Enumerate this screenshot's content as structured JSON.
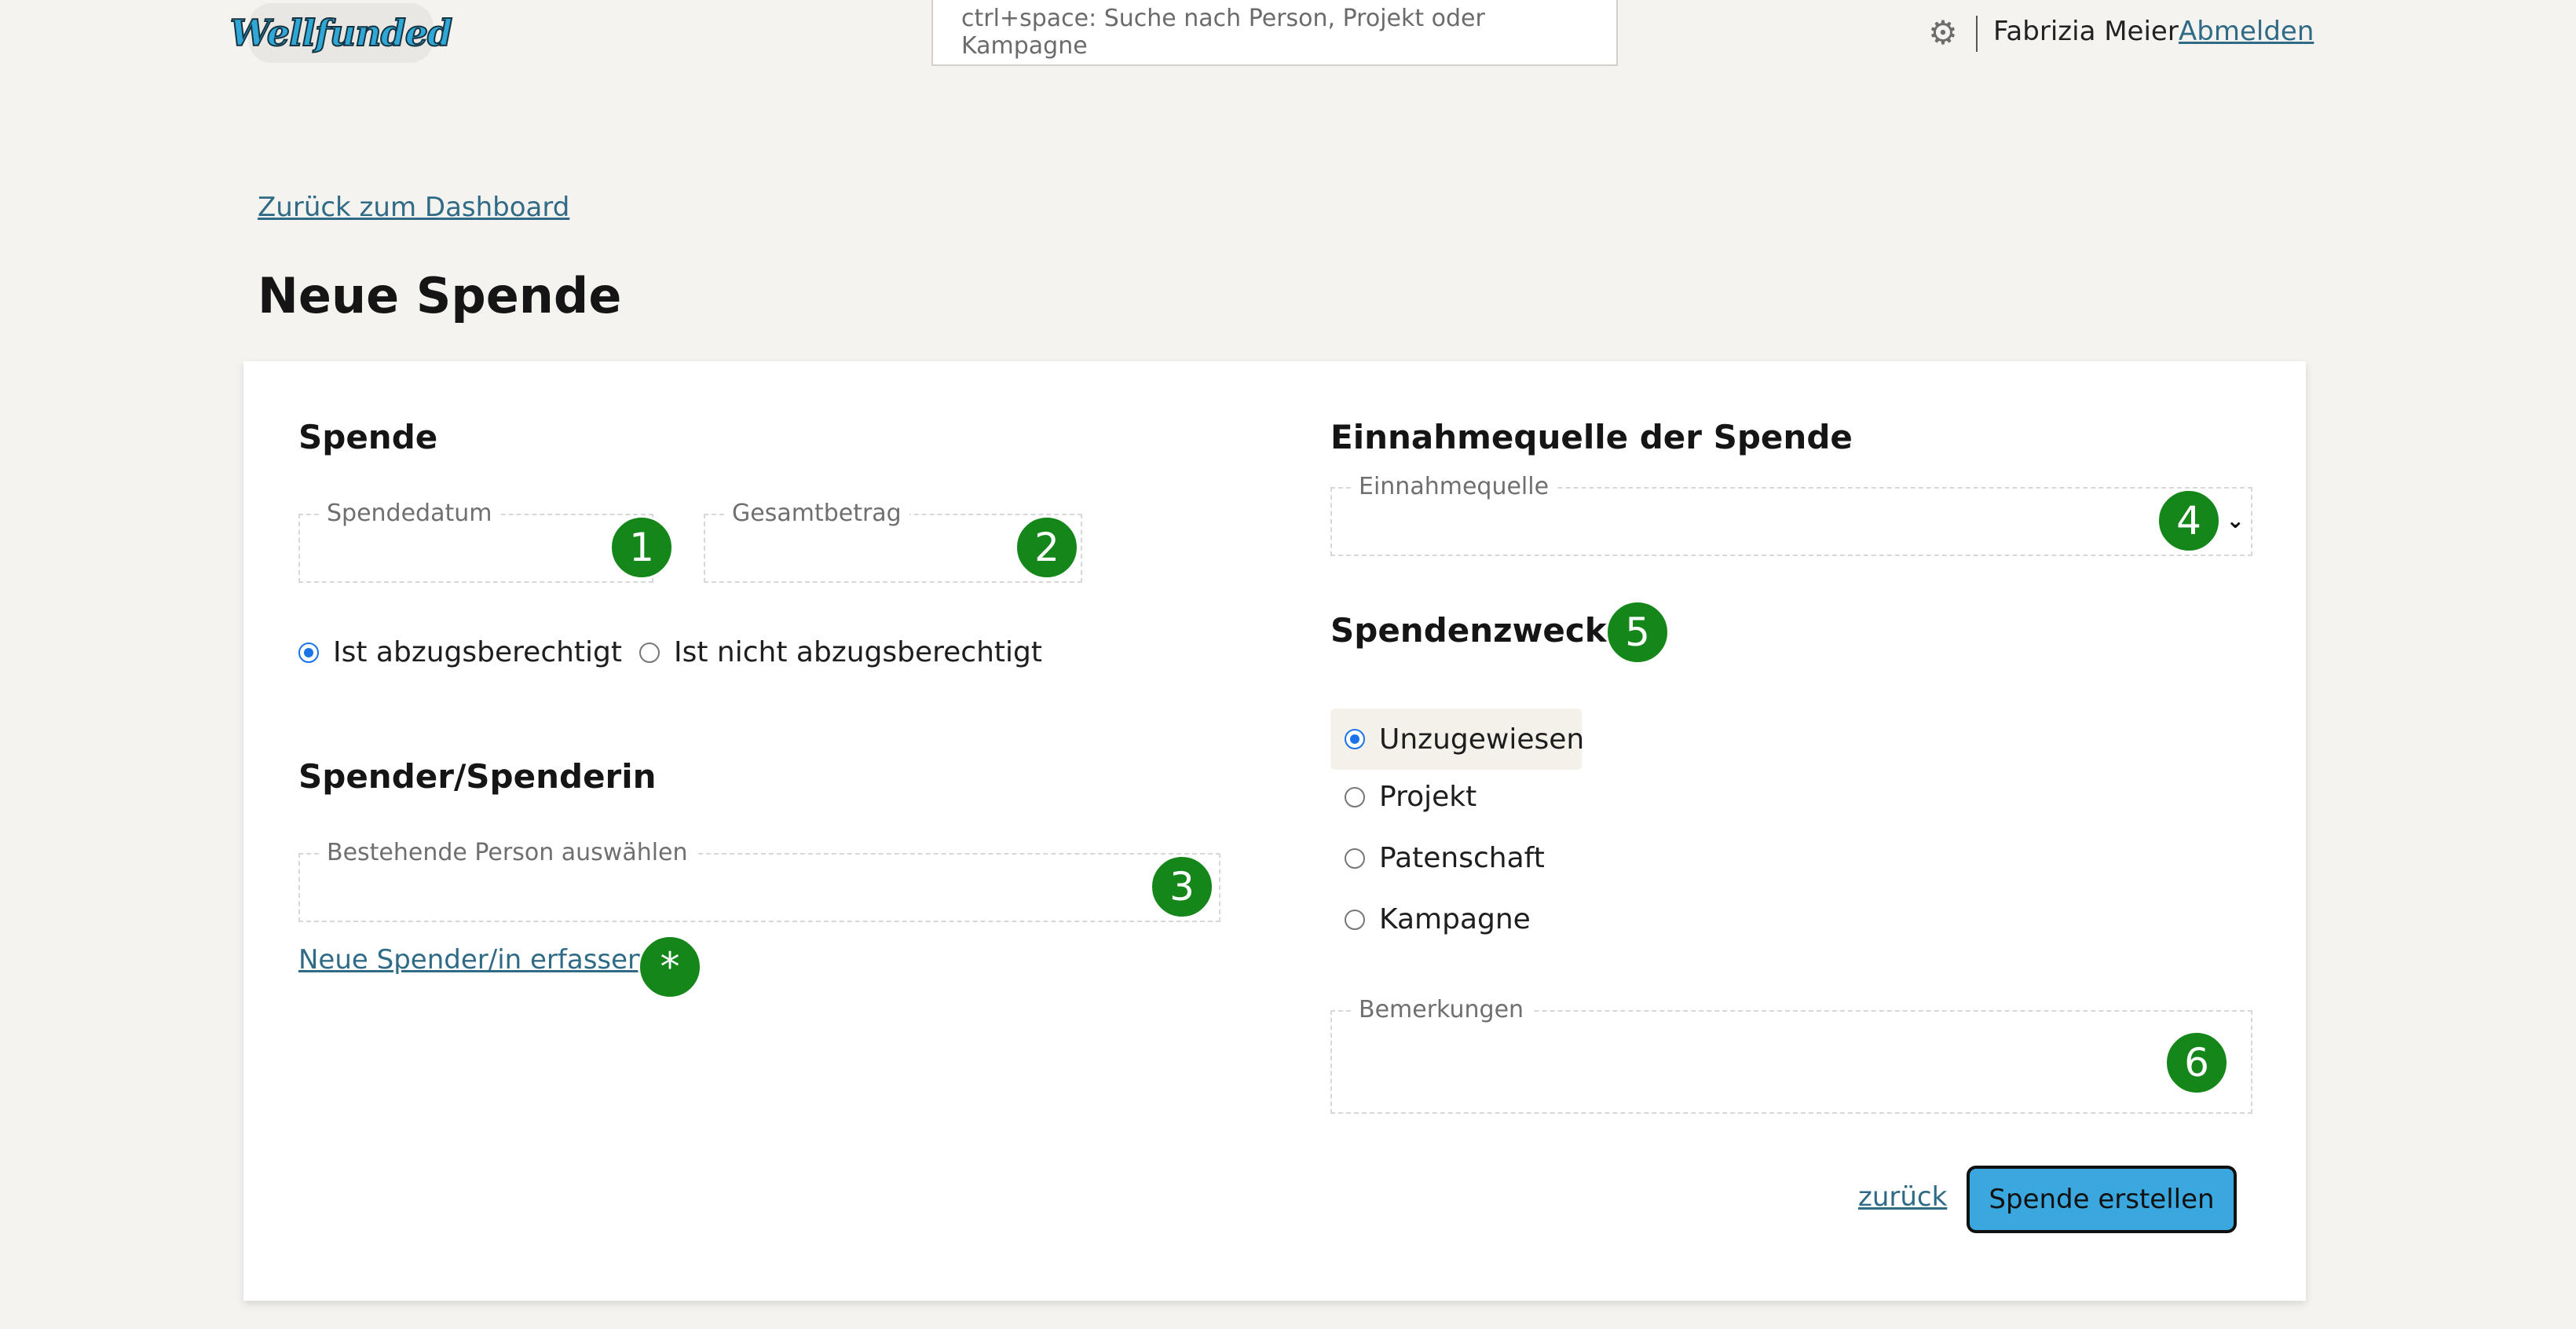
{
  "header": {
    "logo_text": "Wellfunded",
    "search_placeholder": "ctrl+space: Suche nach Person, Projekt oder Kampagne",
    "user_name": "Fabrizia Meier",
    "logout_label": "Abmelden"
  },
  "page": {
    "back_link": "Zurück zum Dashboard",
    "title": "Neue Spende"
  },
  "donation": {
    "heading": "Spende",
    "date_label": "Spendedatum",
    "amount_label": "Gesamtbetrag",
    "deductible_options": [
      "Ist abzugsberechtigt",
      "Ist nicht abzugsberechtigt"
    ],
    "deductible_selected": "Ist abzugsberechtigt"
  },
  "donor": {
    "heading": "Spender/Spenderin",
    "person_label": "Bestehende Person auswählen",
    "new_donor_link": "Neue Spender/in erfassen"
  },
  "income": {
    "heading": "Einnahmequelle der Spende",
    "source_label": "Einnahmequelle"
  },
  "purpose": {
    "heading": "Spendenzweck",
    "options": [
      "Unzugewiesen",
      "Projekt",
      "Patenschaft",
      "Kampagne"
    ],
    "selected": "Unzugewiesen"
  },
  "remarks_label": "Bemerkungen",
  "actions": {
    "back_label": "zurück",
    "create_label": "Spende erstellen"
  },
  "badges": [
    "1",
    "2",
    "3",
    "4",
    "5",
    "6",
    "*"
  ],
  "colors": {
    "badge": "#15871a",
    "primary_button": "#3aa7de",
    "link": "#2f6b86",
    "radio_selected": "#1a73e8"
  }
}
